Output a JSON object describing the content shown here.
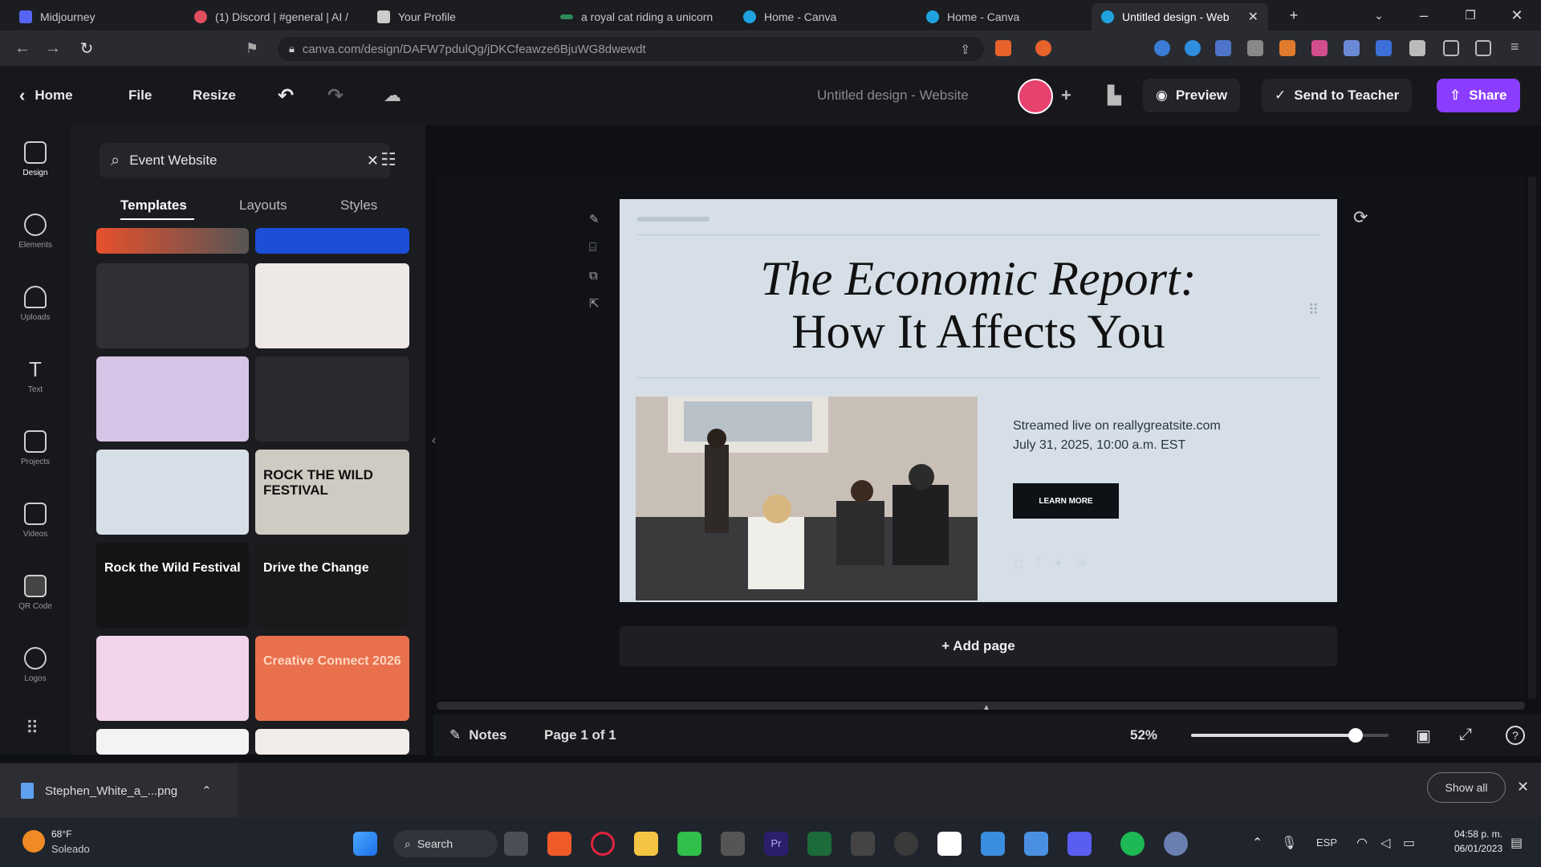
{
  "browser": {
    "tabs": [
      {
        "label": "Midjourney",
        "color": "#5865f2"
      },
      {
        "label": "(1) Discord | #general | AI /",
        "color": "#e04f5f"
      },
      {
        "label": "Your Profile",
        "color": "#cccccc"
      },
      {
        "label": "a royal cat riding a unicorn",
        "color": "#2e8b57"
      },
      {
        "label": "Home - Canva",
        "color": "#1fa3e0"
      },
      {
        "label": "Home - Canva",
        "color": "#1fa3e0"
      },
      {
        "label": "Untitled design - Web",
        "color": "#1fa3e0"
      }
    ],
    "url": "canva.com/design/DAFW7pdulQg/jDKCfeawze6BjuWG8dwewdt"
  },
  "toolbar": {
    "home": "Home",
    "file": "File",
    "resize": "Resize",
    "design_title": "Untitled design - Website",
    "preview": "Preview",
    "send_to_teacher": "Send to Teacher",
    "share": "Share"
  },
  "rail": [
    {
      "label": "Design"
    },
    {
      "label": "Elements"
    },
    {
      "label": "Uploads"
    },
    {
      "label": "Text"
    },
    {
      "label": "Projects"
    },
    {
      "label": "Videos"
    },
    {
      "label": "QR Code"
    },
    {
      "label": "Logos"
    }
  ],
  "panel": {
    "search_value": "Event Website",
    "tabs": [
      "Templates",
      "Layouts",
      "Styles"
    ],
    "thumbs": [
      {
        "text": "",
        "bg": "#2f3036",
        "fg": "#ffffff"
      },
      {
        "text": "",
        "bg": "#eee8e6",
        "fg": "#9a8c88"
      },
      {
        "text": "",
        "bg": "#d6c3e6",
        "fg": "#5b3f75"
      },
      {
        "text": "",
        "bg": "#2a2b2e",
        "fg": "#ffffff"
      },
      {
        "text": "",
        "bg": "#d6dfe7",
        "fg": "#222222"
      },
      {
        "text": "ROCK THE WILD FESTIVAL",
        "bg": "#cfcac2",
        "fg": "#111111"
      },
      {
        "text": "Rock the Wild Festival",
        "bg": "#141414",
        "fg": "#ffffff"
      },
      {
        "text": "Drive the Change",
        "bg": "#1a1a1a",
        "fg": "#ffffff"
      },
      {
        "text": "",
        "bg": "#f1d3ea",
        "fg": "#8a4f84"
      },
      {
        "text": "Creative Connect 2026",
        "bg": "#e8704c",
        "fg": "#ffd6c2"
      }
    ]
  },
  "canvas": {
    "headline_line1": "The Economic Report:",
    "headline_line2": "How It Affects You",
    "stream_info": "Streamed live on reallygreatsite.com",
    "date_info": "July 31, 2025, 10:00 a.m. EST",
    "cta": "LEARN MORE",
    "add_page": "+ Add page"
  },
  "footer": {
    "notes": "Notes",
    "page_info": "Page 1 of 1",
    "zoom": "52%",
    "zoom_level": 0.52
  },
  "downloads": {
    "file": "Stephen_White_a_...png",
    "show_all": "Show all"
  },
  "taskbar": {
    "temp": "68°F",
    "weather": "Soleado",
    "search": "Search",
    "lang": "ESP",
    "time": "04:58 p. m.",
    "date": "06/01/2023"
  },
  "colors": {
    "accent": "#8b3dff"
  }
}
